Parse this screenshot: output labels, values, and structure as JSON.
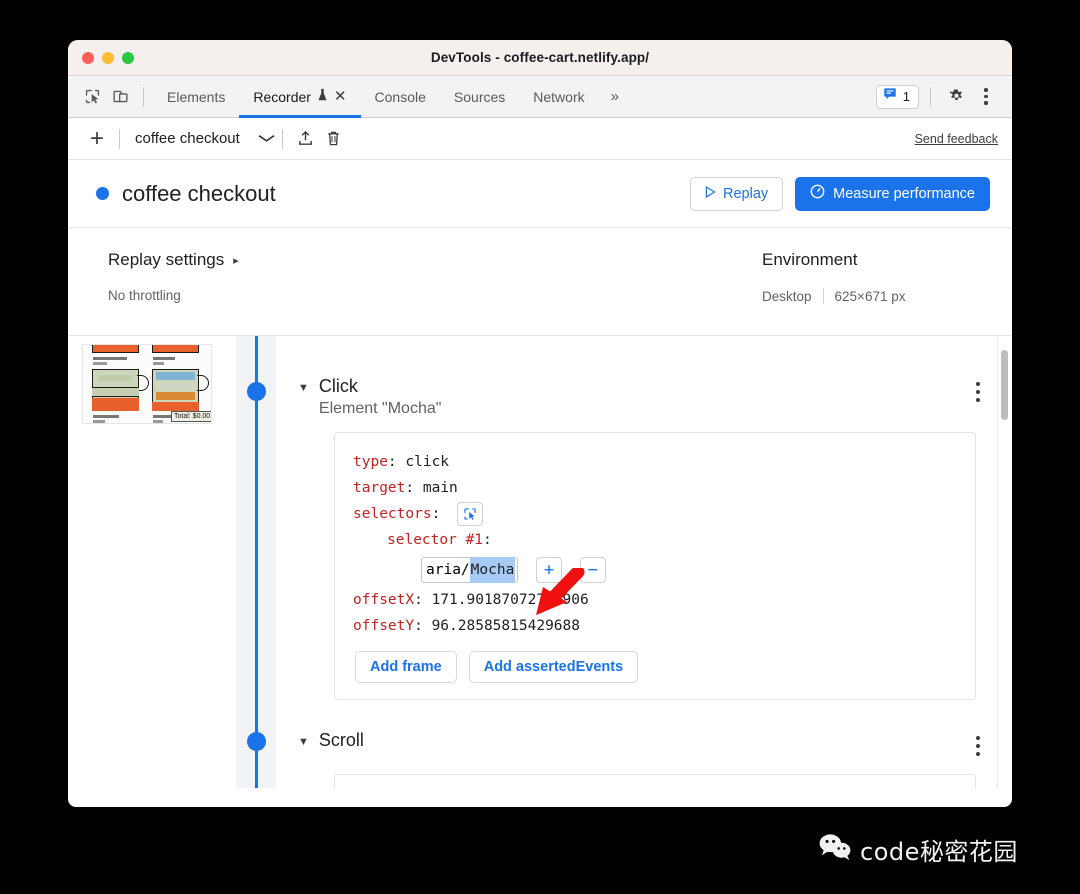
{
  "window": {
    "title": "DevTools - coffee-cart.netlify.app/",
    "traffic_lights": [
      "close",
      "minimize",
      "zoom"
    ]
  },
  "tabstrip": {
    "left_icons": [
      {
        "name": "inspect-element-icon",
        "label": "Inspect element"
      },
      {
        "name": "device-toolbar-icon",
        "label": "Toggle device toolbar"
      }
    ],
    "tabs": [
      {
        "label": "Elements",
        "active": false
      },
      {
        "label": "Recorder",
        "active": true,
        "experimental": true,
        "closable": true
      },
      {
        "label": "Console",
        "active": false
      },
      {
        "label": "Sources",
        "active": false
      },
      {
        "label": "Network",
        "active": false
      }
    ],
    "more_tabs": "»",
    "messages_count": "1",
    "right_icons": [
      {
        "name": "message-icon"
      },
      {
        "name": "gear-icon"
      },
      {
        "name": "kebab-menu-icon"
      }
    ]
  },
  "recorder_toolbar": {
    "add_label": "+",
    "recording_name": "coffee checkout",
    "dropdown_caret": "⌄",
    "export_icon": "export-icon",
    "delete_icon": "trash-icon",
    "feedback_label": "Send feedback"
  },
  "recorder_header": {
    "title": "coffee checkout",
    "replay_label": "Replay",
    "measure_label": "Measure performance"
  },
  "settings": {
    "replay_settings_label": "Replay settings",
    "replay_settings_caret": "▸",
    "throttling_value": "No throttling",
    "environment_label": "Environment",
    "environment_device": "Desktop",
    "environment_viewport": "625×671 px"
  },
  "steps": [
    {
      "caret": "▼",
      "name": "Click",
      "subtitle": "Element \"Mocha\"",
      "code": {
        "type_key": "type",
        "type_value": "click",
        "target_key": "target",
        "target_value": "main",
        "selectors_key": "selectors",
        "selector_label": "selector #1",
        "selector_prefix": "aria/",
        "selector_selected": "Mocha",
        "add_selector_label": "+",
        "remove_selector_label": "−",
        "offsetx_key": "offsetX",
        "offsetx_value": "171.90187072753906",
        "offsety_key": "offsetY",
        "offsety_value": "96.28585815429688",
        "add_frame_label": "Add frame",
        "add_asserted_events_label": "Add assertedEvents"
      }
    },
    {
      "caret": "▼",
      "name": "Scroll",
      "subtitle": "",
      "code": null
    }
  ],
  "thumbnail": {
    "name": "coffee-cart-screenshot",
    "total_label": "Total: $0.00",
    "items": [
      {
        "name": "Cappuccino",
        "price": "$19"
      },
      {
        "name": "Mocha",
        "price": "$8"
      },
      {
        "name": "Cafe Latte",
        "price": "$19"
      },
      {
        "name": "Americano",
        "price": "$13"
      }
    ]
  },
  "watermark": {
    "text": "code秘密花园",
    "logo": "wechat-icon"
  },
  "colors": {
    "accent": "#1a73e8",
    "code_key": "#c5221f",
    "selection": "#a8cbf5",
    "annotation_arrow": "#f01010"
  }
}
